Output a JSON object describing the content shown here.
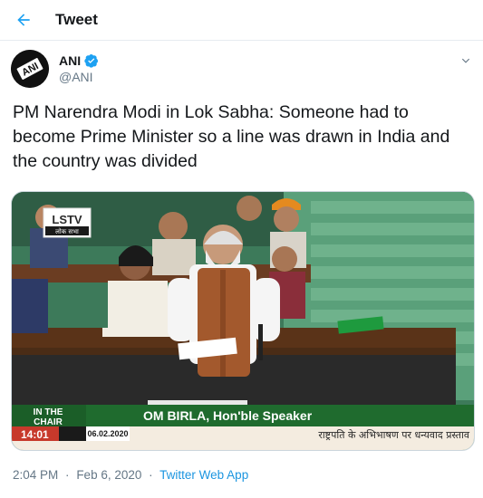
{
  "header": {
    "title": "Tweet"
  },
  "author": {
    "name": "ANI",
    "handle": "@ANI",
    "avatar_text": "ANI",
    "verified": true
  },
  "tweet": {
    "text": "PM Narendra Modi in Lok Sabha: Someone had to become Prime Minister so a line was drawn in India and the country was divided"
  },
  "media": {
    "channel_logo": "LSTV",
    "channel_logo_sub": "लोक सभा",
    "chair_label_line1": "IN THE",
    "chair_label_line2": "CHAIR",
    "time": "14:01",
    "date": "06.02.2020",
    "speaker_caption": "OM BIRLA, Hon'ble Speaker",
    "ticker_text": "राष्ट्रपति के अभिभाषण पर धन्यवाद प्रस्ताव"
  },
  "meta": {
    "time": "2:04 PM",
    "date": "Feb 6, 2020",
    "separator": "·",
    "source": "Twitter Web App"
  },
  "colors": {
    "accent": "#1da1f2",
    "muted": "#657786",
    "caption_green": "#1f6b2e",
    "ticker_bg": "#f4ece0"
  },
  "icons": {
    "back": "arrow-left-icon",
    "verified": "verified-badge-icon",
    "caret": "chevron-down-icon"
  }
}
